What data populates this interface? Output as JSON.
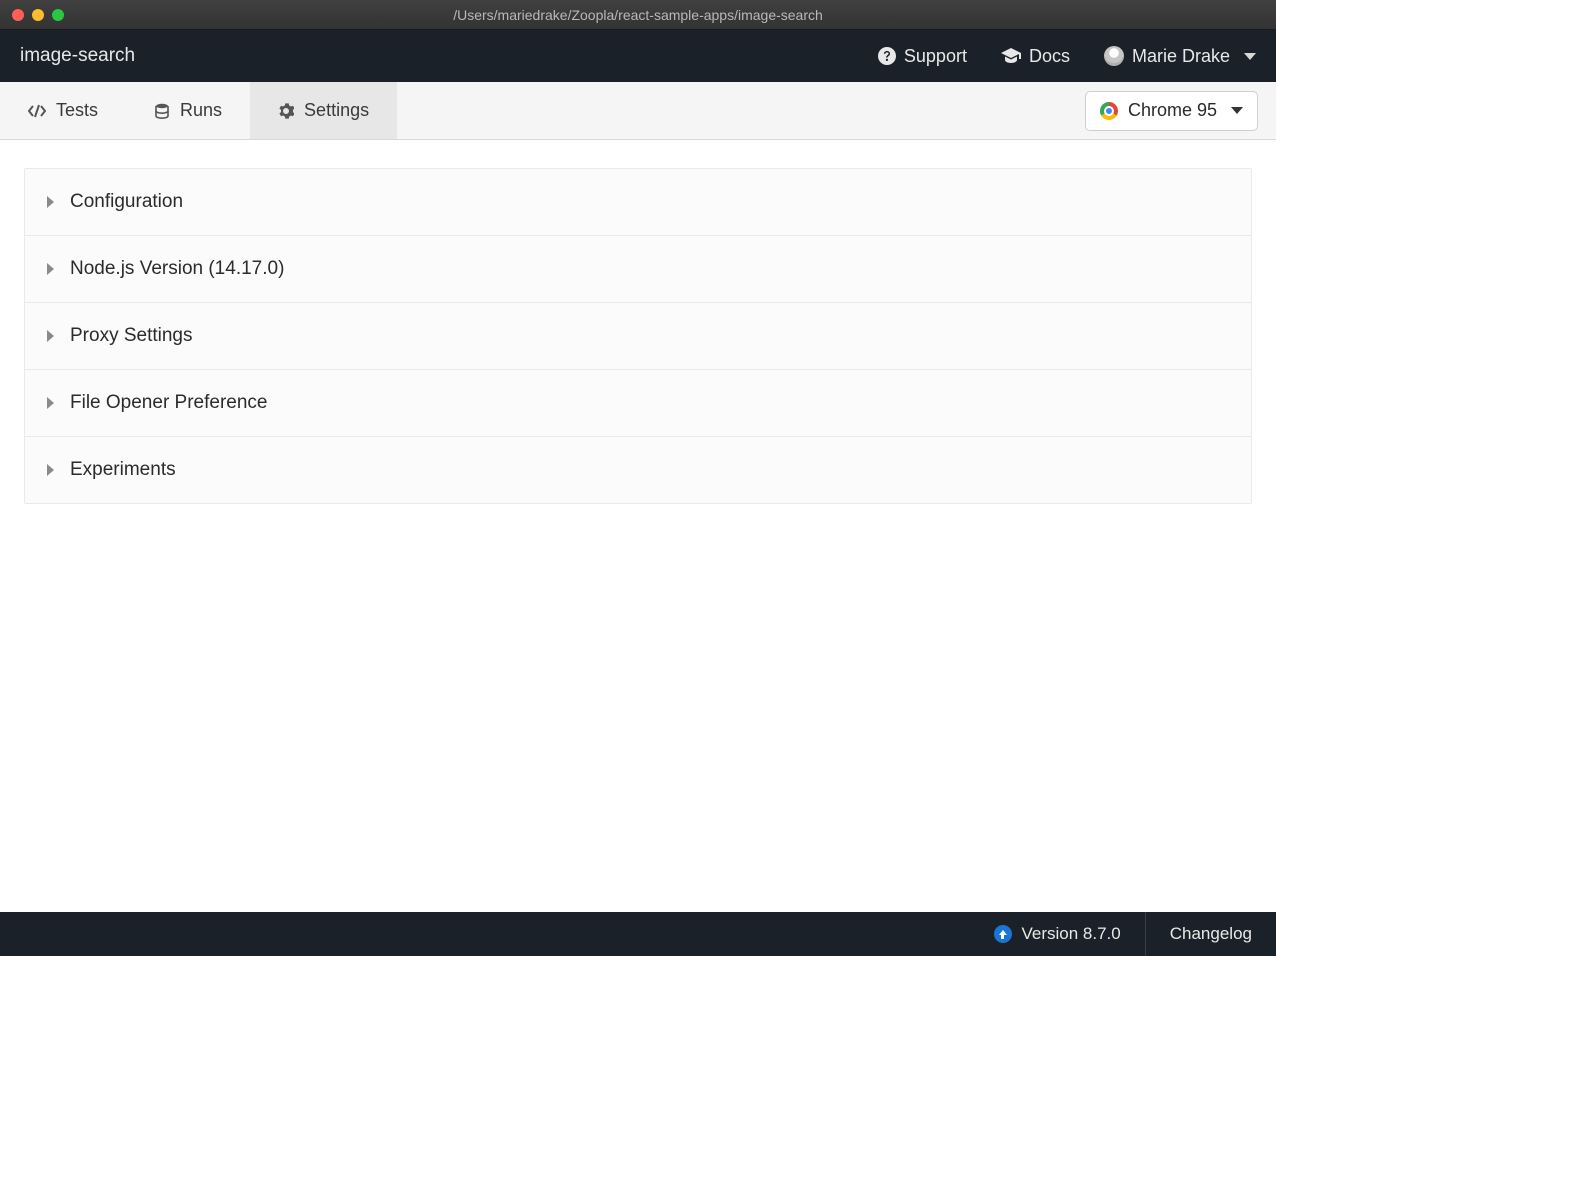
{
  "titlebar": {
    "path": "/Users/mariedrake/Zoopla/react-sample-apps/image-search"
  },
  "header": {
    "project_name": "image-search",
    "support_label": "Support",
    "docs_label": "Docs",
    "user_name": "Marie Drake"
  },
  "tabs": {
    "items": [
      {
        "label": "Tests"
      },
      {
        "label": "Runs"
      },
      {
        "label": "Settings"
      }
    ],
    "browser_label": "Chrome 95"
  },
  "settings": {
    "rows": [
      {
        "label": "Configuration"
      },
      {
        "label": "Node.js Version (14.17.0)"
      },
      {
        "label": "Proxy Settings"
      },
      {
        "label": "File Opener Preference"
      },
      {
        "label": "Experiments"
      }
    ]
  },
  "footer": {
    "version_label": "Version 8.7.0",
    "changelog_label": "Changelog"
  }
}
